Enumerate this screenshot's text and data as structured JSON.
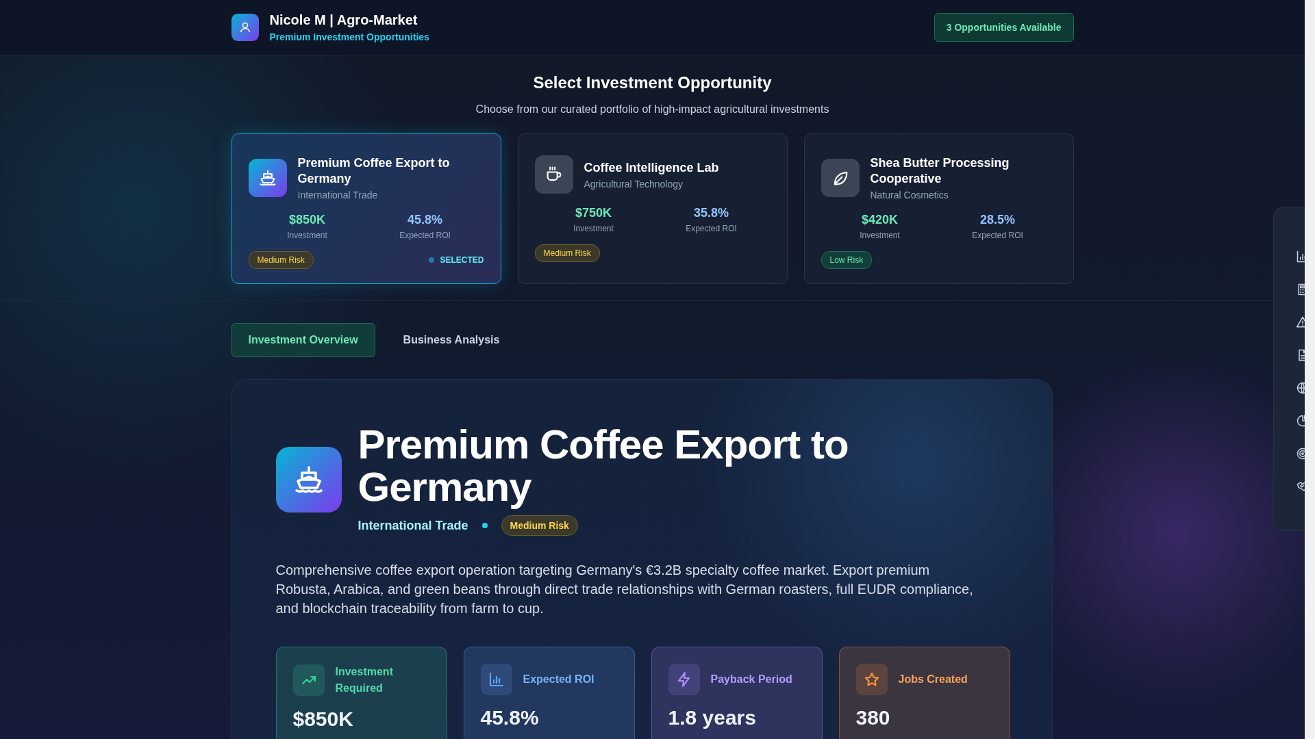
{
  "header": {
    "title": "Nicole M | Agro-Market",
    "subtitle": "Premium Investment Opportunities",
    "badge": "3 Opportunities Available"
  },
  "intro": {
    "title": "Select Investment Opportunity",
    "text": "Choose from our curated portfolio of high-impact agricultural investments"
  },
  "opportunities": {
    "selected_label": "SELECTED",
    "items": [
      {
        "title": "Premium Coffee Export to Germany",
        "category": "International Trade",
        "investment": "$850K",
        "investment_label": "Investment",
        "roi": "45.8%",
        "roi_label": "Expected ROI",
        "risk": {
          "label": "Medium Risk",
          "kind": "medium"
        },
        "selected": true
      },
      {
        "title": "Coffee Intelligence Lab",
        "category": "Agricultural Technology",
        "investment": "$750K",
        "investment_label": "Investment",
        "roi": "35.8%",
        "roi_label": "Expected ROI",
        "risk": {
          "label": "Medium Risk",
          "kind": "medium"
        },
        "selected": false
      },
      {
        "title": "Shea Butter Processing Cooperative",
        "category": "Natural Cosmetics",
        "investment": "$420K",
        "investment_label": "Investment",
        "roi": "28.5%",
        "roi_label": "Expected ROI",
        "risk": {
          "label": "Low Risk",
          "kind": "low"
        },
        "selected": false
      }
    ]
  },
  "tabs": [
    {
      "label": "Investment Overview",
      "selected": true
    },
    {
      "label": "Business Analysis",
      "selected": false
    }
  ],
  "detail": {
    "title": "Premium Coffee Export to Germany",
    "category": "International Trade",
    "risk": {
      "label": "Medium Risk",
      "kind": "medium"
    },
    "description": "Comprehensive coffee export operation targeting Germany's €3.2B specialty coffee market. Export premium Robusta, Arabica, and green beans through direct trade relationships with German roasters, full EUDR compliance, and blockchain traceability from farm to cup.",
    "stats": [
      {
        "label": "Investment Required",
        "value": "$850K",
        "color": "#34d399"
      },
      {
        "label": "Expected ROI",
        "value": "45.8%",
        "color": "#60a5fa"
      },
      {
        "label": "Payback Period",
        "value": "1.8 years",
        "color": "#a78bfa"
      },
      {
        "label": "Jobs Created",
        "value": "380",
        "color": "#fb923c"
      }
    ]
  }
}
